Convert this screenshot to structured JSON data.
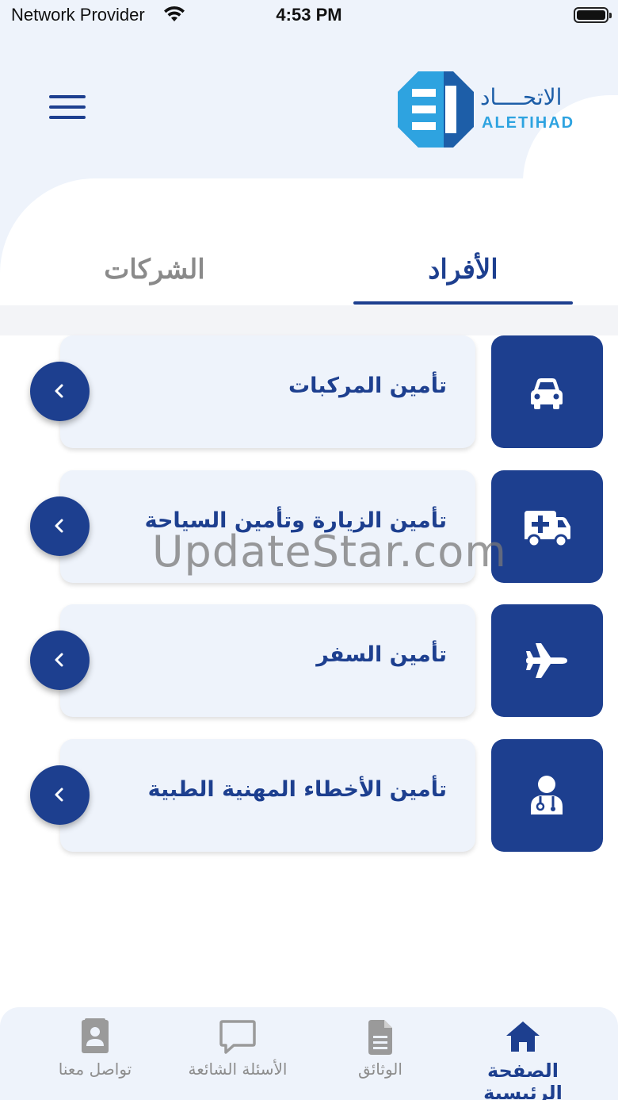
{
  "status_bar": {
    "carrier": "Network Provider",
    "time": "4:53 PM"
  },
  "brand": {
    "name_ar": "الاتحــــاد",
    "name_en": "ALETIHAD",
    "primary_color": "#1d3f8f",
    "accent_color": "#2ea3e0"
  },
  "tabs": {
    "individuals": "الأفراد",
    "companies": "الشركات",
    "active": "individuals"
  },
  "products": [
    {
      "label": "تأمين المركبات",
      "icon": "car-icon"
    },
    {
      "label": "تأمين الزيارة وتأمين السياحة",
      "icon": "ambulance-icon"
    },
    {
      "label": "تأمين السفر",
      "icon": "airplane-icon"
    },
    {
      "label": "تأمين الأخطاء المهنية الطبية",
      "icon": "doctor-icon"
    }
  ],
  "watermark": "UpdateStar.com",
  "bottom_nav": {
    "home": "الصفحة الرئيسية",
    "documents": "الوثائق",
    "faq": "الأسئلة الشائعة",
    "contact": "تواصل معنا",
    "active": "home"
  }
}
